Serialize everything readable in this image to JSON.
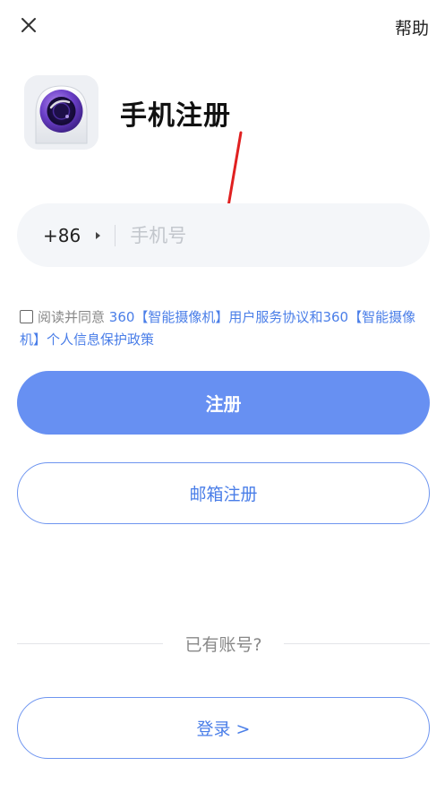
{
  "header": {
    "close_icon": "close-icon",
    "help_label": "帮助"
  },
  "app": {
    "icon": "camera-lens-icon",
    "title": "手机注册"
  },
  "phone": {
    "country_code": "+86",
    "placeholder": "手机号",
    "value": ""
  },
  "agreement": {
    "checked": false,
    "prefix": "阅读并同意",
    "user_agreement": "360【智能摄像机】用户服务协议",
    "conjunction": "和",
    "privacy_policy": "360【智能摄像机】个人信息保护政策"
  },
  "buttons": {
    "register_label": "注册",
    "email_register_label": "邮箱注册",
    "login_label": "登录 >"
  },
  "divider": {
    "text": "已有账号?"
  },
  "colors": {
    "primary": "#6790f2",
    "link": "#4a7ee8",
    "annotation_arrow": "#e02020"
  }
}
